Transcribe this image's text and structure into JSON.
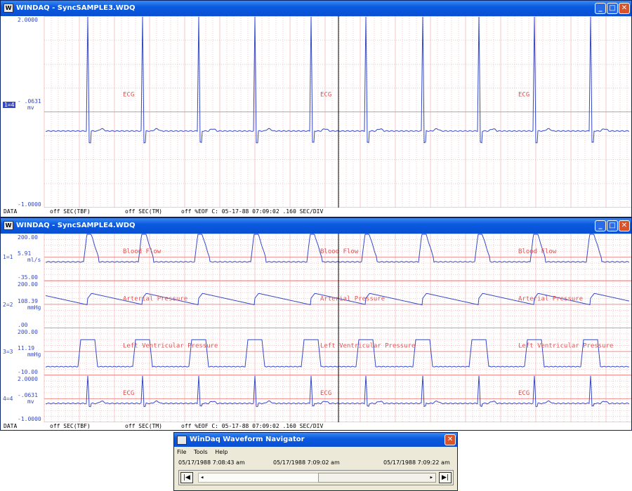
{
  "colors": {
    "grid": "#f08f8f",
    "trace": "#3549c7",
    "label": "#e05050",
    "titlebar": "#0a54dc"
  },
  "win1": {
    "title": "WINDAQ - SyncSAMPLE3.WDQ",
    "icon": "W",
    "channels": [
      {
        "num": "1=4",
        "top": "2.0000",
        "mid": "- .0631",
        "unit": "mv",
        "bottom": "-1.0000",
        "name": "ECG",
        "type": "ecg"
      }
    ],
    "status": [
      "DATA",
      "off SEC(TBF)",
      "off SEC(TM)",
      "off %EOF C: 05-17-88 07:09:02 .160 SEC/DIV"
    ]
  },
  "win2": {
    "title": "WINDAQ - SyncSAMPLE4.WDQ",
    "icon": "W",
    "channels": [
      {
        "num": "1=1",
        "top": "200.00",
        "mid": "5.91",
        "unit": "ml/s",
        "bottom": "-35.00",
        "name": "Blood Flow",
        "type": "flow"
      },
      {
        "num": "2=2",
        "top": "200.00",
        "mid": "108.39",
        "unit": "mmHg",
        "bottom": ".00",
        "name": "Arterial Pressure",
        "type": "art"
      },
      {
        "num": "3=3",
        "top": "200.00",
        "mid": "11.19",
        "unit": "mmHg",
        "bottom": "-10.00",
        "name": "Left Ventricular Pressure",
        "type": "lvp"
      },
      {
        "num": "4=4",
        "top": "2.0000",
        "mid": "-.0631",
        "unit": "mv",
        "bottom": "-1.0000",
        "name": "ECG",
        "type": "ecg"
      }
    ],
    "status": [
      "DATA",
      "off SEC(TBF)",
      "off SEC(TM)",
      "off %EOF C: 05-17-88 07:09:02 .160 SEC/DIV"
    ]
  },
  "navigator": {
    "title": "WinDaq Waveform Navigator",
    "menu": [
      "File",
      "Tools",
      "Help"
    ],
    "times": [
      "05/17/1988 7:08:43 am",
      "05/17/1988 7:09:02 am",
      "05/17/1988 7:09:22 am"
    ],
    "first_btn": "|◀",
    "last_btn": "▶|",
    "prev_btn": "◂",
    "next_btn": "▸"
  },
  "window_buttons": {
    "min": "_",
    "max": "□",
    "close": "✕"
  }
}
